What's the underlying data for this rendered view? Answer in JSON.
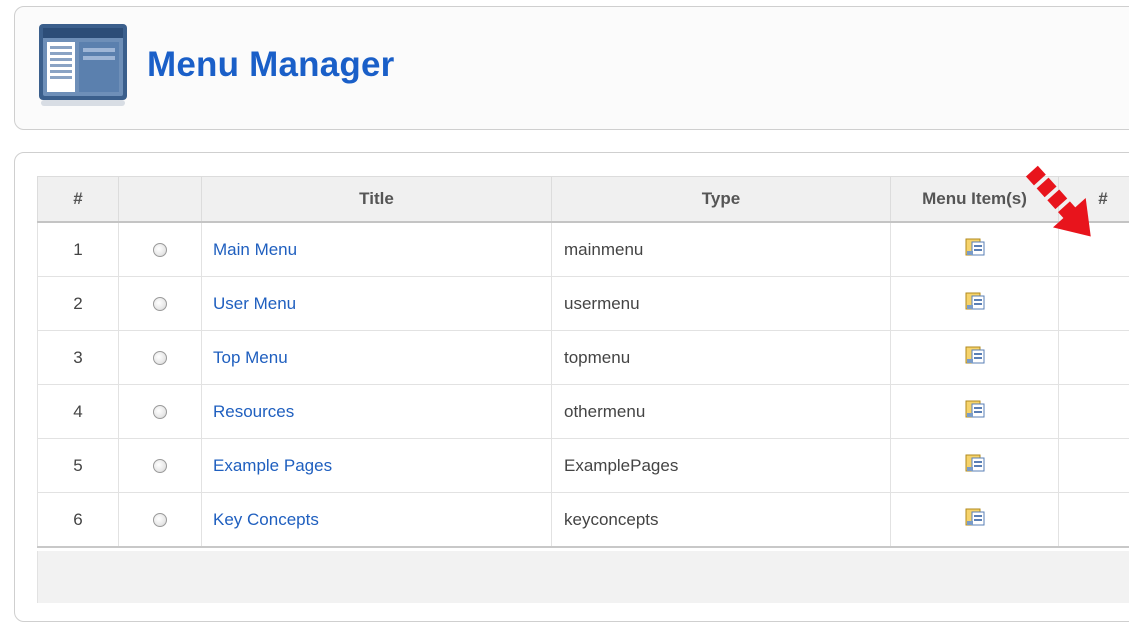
{
  "header": {
    "title": "Menu Manager",
    "icon": "menu-manager-icon"
  },
  "table": {
    "columns": [
      "#",
      "",
      "Title",
      "Type",
      "Menu Item(s)",
      "#"
    ],
    "rows": [
      {
        "num": "1",
        "title": "Main Menu",
        "type": "mainmenu"
      },
      {
        "num": "2",
        "title": "User Menu",
        "type": "usermenu"
      },
      {
        "num": "3",
        "title": "Top Menu",
        "type": "topmenu"
      },
      {
        "num": "4",
        "title": "Resources",
        "type": "othermenu"
      },
      {
        "num": "5",
        "title": "Example Pages",
        "type": "ExamplePages"
      },
      {
        "num": "6",
        "title": "Key Concepts",
        "type": "keyconcepts"
      }
    ],
    "row_icon": "edit-menu-items-icon"
  },
  "colors": {
    "title": "#1a5fc8",
    "link": "#1f5fbf",
    "annotation": "#e8141c"
  }
}
